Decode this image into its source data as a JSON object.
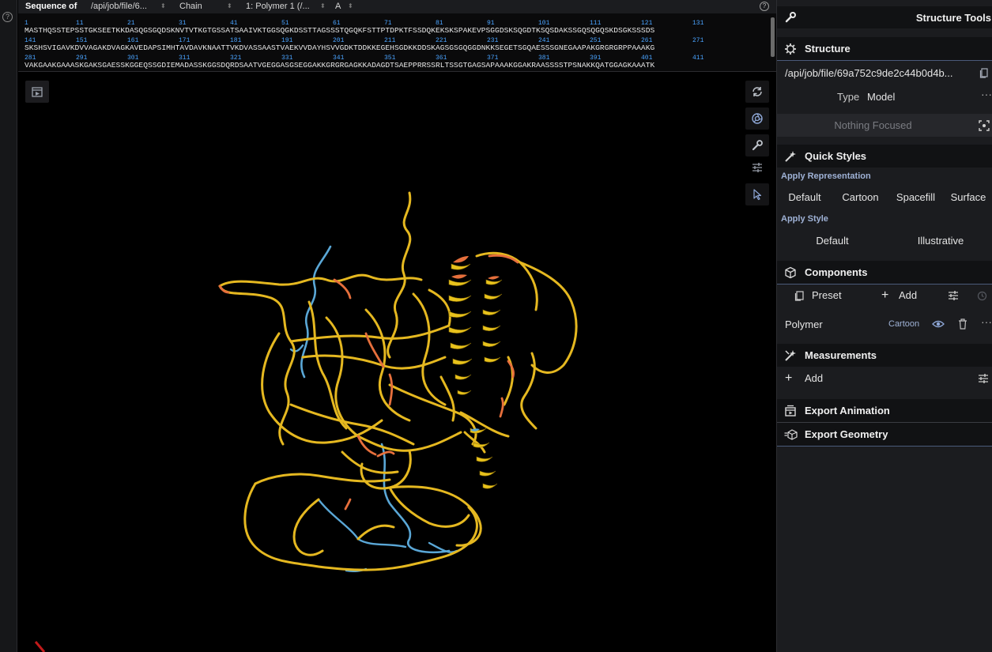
{
  "sequence_panel": {
    "label": "Sequence of",
    "source": "/api/job/file/6...",
    "chain_label": "Chain",
    "polymer": "1: Polymer 1 (/...",
    "chain_id": "A",
    "rows": [
      {
        "numbers": [
          "1",
          "11",
          "21",
          "31",
          "41",
          "51",
          "61",
          "71",
          "81",
          "91",
          "101",
          "111",
          "121",
          "131"
        ],
        "text": "MASTHQSSTEPSSTGKSEETKKDASQGSGQDSKNVTVTKGTGSSATSAAIVKTGGSQGKDSSTTAGSSSTQGQKFSTTPTDPKTFSSDQKEKSKSPAKEVPSGGDSKSQGDTKSQSDAKSSGQSQGQSKDSGKSSSDS"
      },
      {
        "numbers": [
          "141",
          "151",
          "161",
          "171",
          "181",
          "191",
          "201",
          "211",
          "221",
          "231",
          "241",
          "251",
          "261",
          "271"
        ],
        "text": "SKSHSVIGAVKDVVAGAKDVAGKAVEDAPSIMHTAVDAVKNAATTVKDVASSAASTVAEKVVDAYHSVVGDKTDDKKEGEHSGDKKDDSKAGSGSGQGGDNKKSEGETSGQAESSSGNEGAAPAKGRGRGRPPAAAKG"
      },
      {
        "numbers": [
          "281",
          "291",
          "301",
          "311",
          "321",
          "331",
          "341",
          "351",
          "361",
          "371",
          "381",
          "391",
          "401",
          "411"
        ],
        "text": "VAKGAAKGAAASKGAKSGAESSKGGEQSSGDIEMADASSKGGSDQRDSAATVGEGGASGSEGGAKKGRGRGAGKKADAGDTSAEPPRRSSRLTSSGTGAGSAPAAAKGGAKRAASSSSTPSNAKKQATGGAGKAAATK"
      }
    ]
  },
  "viewport": {
    "left_tools": [
      "screenshot-icon"
    ],
    "right_tools": [
      "reset-camera-icon",
      "camera-icon",
      "wrench-icon",
      "sliders-icon",
      "cursor-icon"
    ],
    "colors": {
      "helix": "#e8c21c",
      "coil": "#e5b820",
      "low_confidence": "#e66f3c",
      "very_low_confidence": "#5aa7d6"
    }
  },
  "right_panel": {
    "title": "Structure Tools",
    "structure": {
      "title": "Structure",
      "path": "/api/job/file/69a752c9de2c44b0d4b...",
      "type_label": "Type",
      "type_value": "Model",
      "focus_text": "Nothing Focused"
    },
    "quick_styles": {
      "title": "Quick Styles",
      "apply_representation_label": "Apply Representation",
      "representations": [
        "Default",
        "Cartoon",
        "Spacefill",
        "Surface"
      ],
      "apply_style_label": "Apply Style",
      "styles": [
        "Default",
        "Illustrative"
      ]
    },
    "components": {
      "title": "Components",
      "preset_label": "Preset",
      "add_label": "Add",
      "polymer_label": "Polymer",
      "polymer_repr": "Cartoon"
    },
    "measurements": {
      "title": "Measurements",
      "add_label": "Add"
    },
    "export_animation": {
      "title": "Export Animation"
    },
    "export_geometry": {
      "title": "Export Geometry"
    }
  }
}
